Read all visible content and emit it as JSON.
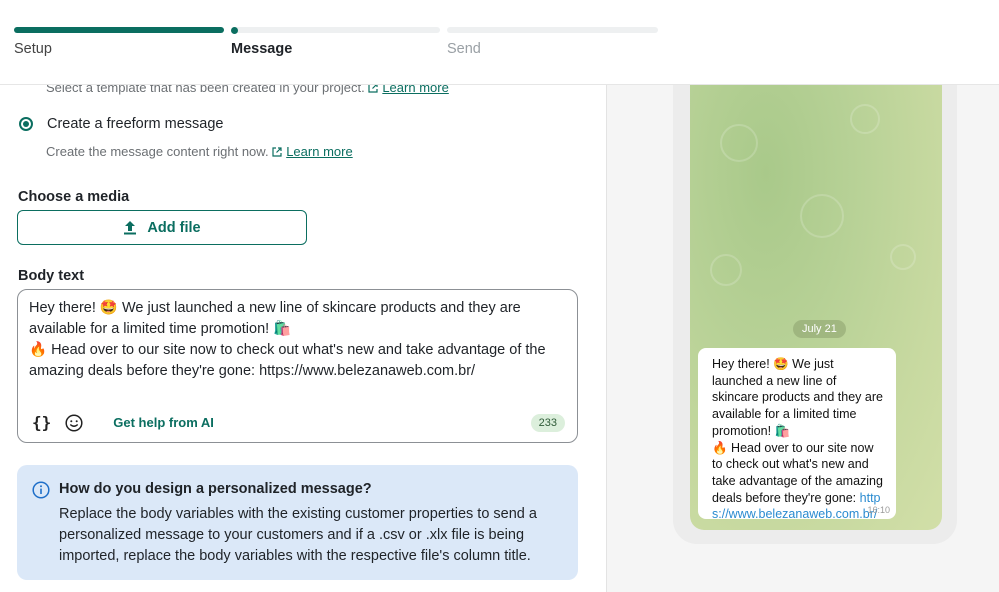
{
  "stepper": {
    "steps": [
      {
        "label": "Setup",
        "state": "complete"
      },
      {
        "label": "Message",
        "state": "current"
      },
      {
        "label": "Send",
        "state": "upcoming"
      }
    ]
  },
  "form": {
    "template_option": {
      "description": "Select a template that has been created in your project.",
      "learn_more": "Learn more"
    },
    "freeform_option": {
      "label": "Create a freeform message",
      "selected": true,
      "description": "Create the message content right now.",
      "learn_more": "Learn more"
    },
    "media": {
      "label": "Choose a media",
      "add_file_label": "Add file"
    },
    "body": {
      "label": "Body text",
      "line1": "Hey there! 🤩 We just launched a new line of skincare products and they are available for a limited time promotion! 🛍️",
      "line2": "🔥 Head over to our site now to check out what's new and take advantage of the amazing deals before they're gone: https://www.belezanaweb.com.br/",
      "variables_icon": "{}",
      "ai_help": "Get help from AI",
      "char_count": "233"
    },
    "info": {
      "title": "How do you design a personalized message?",
      "body": "Replace the body variables with the existing customer properties to send a personalized message to your customers and if a .csv or .xlx file is being imported, replace the body variables with the respective file's column title."
    }
  },
  "preview": {
    "date": "July 21",
    "message_text": "Hey there! 🤩 We just launched a new line of skincare products and they are available for a limited time promotion! 🛍️\n🔥 Head over to our site now to check out what's new and take advantage of the amazing deals before they're gone: ",
    "message_link": "https://www.belezanaweb.com.br/",
    "time": "16:10"
  },
  "colors": {
    "accent": "#0b6e60",
    "info_bg": "#dbe8f8",
    "counter_bg": "#dcefdc"
  }
}
